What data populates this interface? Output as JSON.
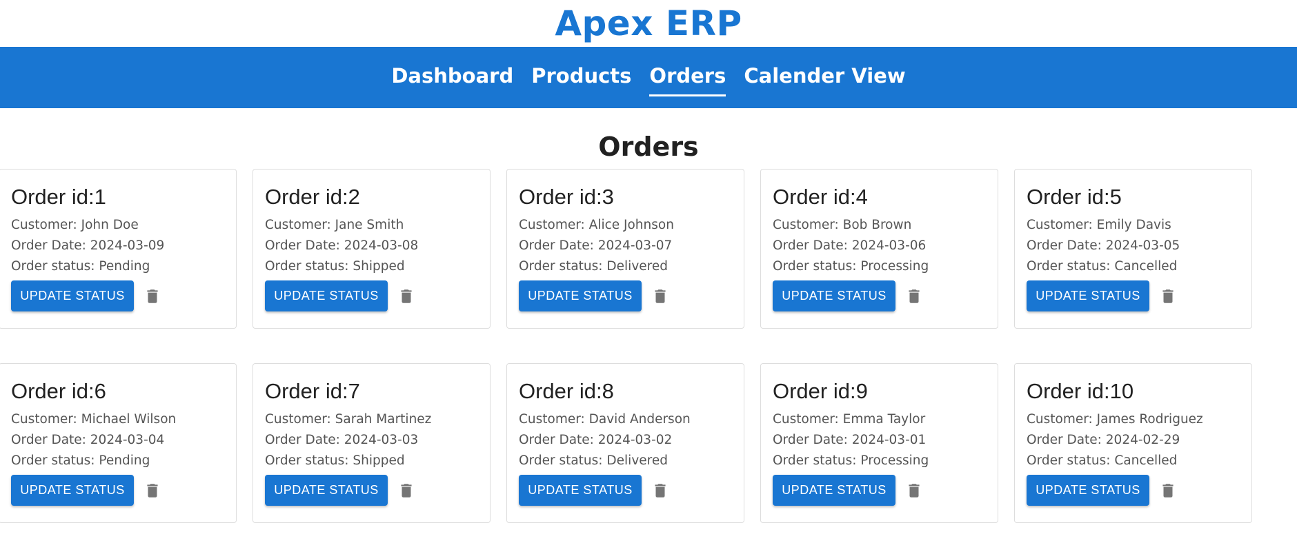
{
  "app": {
    "title": "Apex ERP"
  },
  "nav": {
    "items": [
      {
        "label": "Dashboard",
        "active": false
      },
      {
        "label": "Products",
        "active": false
      },
      {
        "label": "Orders",
        "active": true
      },
      {
        "label": "Calender View",
        "active": false
      }
    ]
  },
  "page": {
    "title": "Orders"
  },
  "labels": {
    "order_prefix": "Order id:",
    "customer_prefix": "Customer: ",
    "date_prefix": "Order Date: ",
    "status_prefix": "Order status: ",
    "update_button": "UPDATE STATUS"
  },
  "orders": [
    {
      "id": "1",
      "customer": "John Doe",
      "date": "2024-03-09",
      "status": "Pending"
    },
    {
      "id": "2",
      "customer": "Jane Smith",
      "date": "2024-03-08",
      "status": "Shipped"
    },
    {
      "id": "3",
      "customer": "Alice Johnson",
      "date": "2024-03-07",
      "status": "Delivered"
    },
    {
      "id": "4",
      "customer": "Bob Brown",
      "date": "2024-03-06",
      "status": "Processing"
    },
    {
      "id": "5",
      "customer": "Emily Davis",
      "date": "2024-03-05",
      "status": "Cancelled"
    },
    {
      "id": "6",
      "customer": "Michael Wilson",
      "date": "2024-03-04",
      "status": "Pending"
    },
    {
      "id": "7",
      "customer": "Sarah Martinez",
      "date": "2024-03-03",
      "status": "Shipped"
    },
    {
      "id": "8",
      "customer": "David Anderson",
      "date": "2024-03-02",
      "status": "Delivered"
    },
    {
      "id": "9",
      "customer": "Emma Taylor",
      "date": "2024-03-01",
      "status": "Processing"
    },
    {
      "id": "10",
      "customer": "James Rodriguez",
      "date": "2024-02-29",
      "status": "Cancelled"
    }
  ],
  "colors": {
    "primary": "#1976d2",
    "icon": "#757575"
  }
}
